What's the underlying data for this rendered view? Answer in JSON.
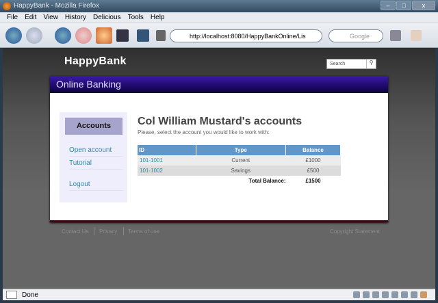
{
  "window": {
    "title": "HappyBank - Mozilla Firefox"
  },
  "menu": [
    "File",
    "Edit",
    "View",
    "History",
    "Delicious",
    "Tools",
    "Help"
  ],
  "toolbar": {
    "url": "http://localhost:8080/HappyBankOnline/Lis",
    "search_placeholder": "Google"
  },
  "site": {
    "logo": "HappyBank",
    "search_placeholder": "Search",
    "banner": "Online Banking"
  },
  "sidebar": {
    "active": "Accounts",
    "links": [
      "Open account",
      "Tutorial",
      "Logout"
    ]
  },
  "main": {
    "title": "Col William Mustard's accounts",
    "subtitle": "Please, select the account you would like to work with:",
    "columns": [
      "ID",
      "Type",
      "Balance"
    ],
    "rows": [
      {
        "id": "101-1001",
        "type": "Current",
        "balance": "£1000"
      },
      {
        "id": "101-1002",
        "type": "Savings",
        "balance": "£500"
      }
    ],
    "total_label": "Total Balance:",
    "total_value": "£1500"
  },
  "footer": {
    "links": [
      "Contact Us",
      "Privacy",
      "Terms of use"
    ],
    "copyright": "Copyright Statement"
  },
  "status": {
    "text": "Done"
  }
}
